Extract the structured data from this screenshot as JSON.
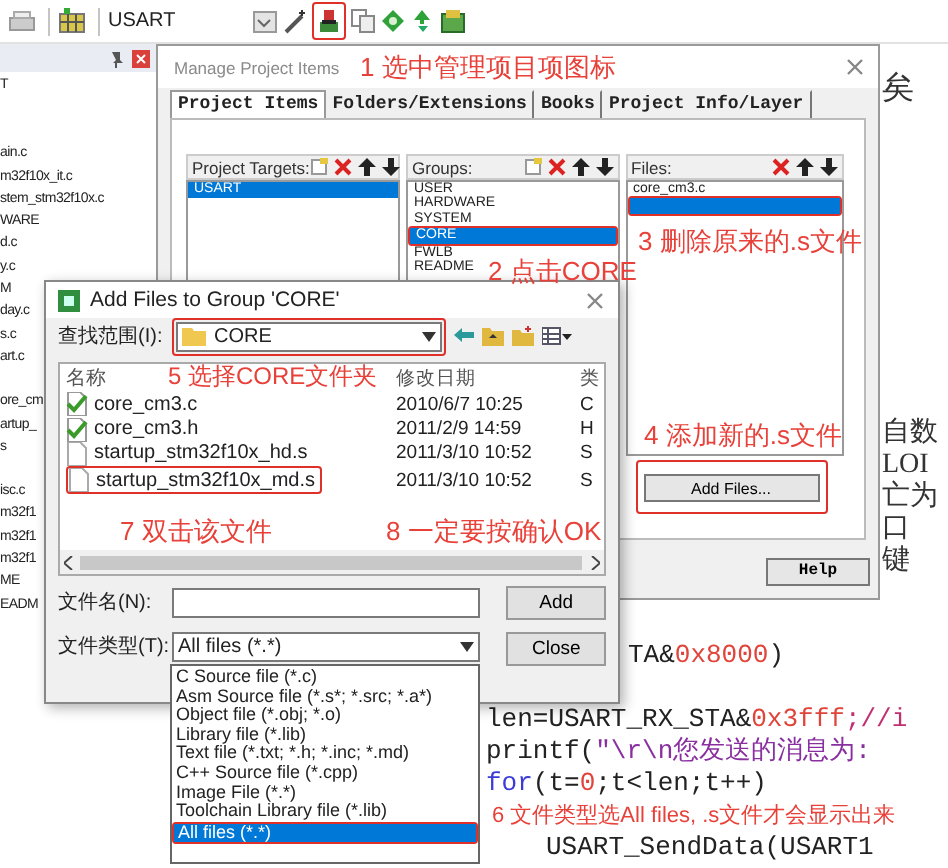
{
  "toolbar": {
    "target": "USART"
  },
  "sidebar": {
    "root": "T",
    "items": [
      "ain.c",
      "m32f10x_it.c",
      "stem_stm32f10x.c",
      "WARE",
      "d.c",
      "y.c",
      "M",
      "day.c",
      "s.c",
      "art.c",
      "ore_cm",
      "artup_",
      "s",
      "isc.c",
      "m32f1",
      "m32f1",
      "m32f1",
      "ME",
      "EADM"
    ]
  },
  "code_editor": {
    "side_fragments": [
      "矣",
      "自数",
      "LOI",
      "亡为",
      "口",
      "键"
    ],
    "partial_line": [
      {
        "text": "TA&",
        "kind": "plain"
      },
      {
        "text": "0x8000",
        "kind": "number"
      },
      {
        "text": ")",
        "kind": "plain"
      }
    ],
    "lines": [
      [
        {
          "text": "len=USART_RX_STA&",
          "kind": "plain"
        },
        {
          "text": "0x3fff",
          "kind": "number"
        },
        {
          "text": ";//i",
          "kind": "comment"
        }
      ],
      [
        {
          "text": "printf(",
          "kind": "plain"
        },
        {
          "text": "\"\\r\\n您发送的消息为:",
          "kind": "string"
        }
      ],
      [
        {
          "text": "for",
          "kind": "keyword"
        },
        {
          "text": "(t=",
          "kind": "plain"
        },
        {
          "text": "0",
          "kind": "number"
        },
        {
          "text": ";t<len;t++)",
          "kind": "plain"
        }
      ]
    ],
    "last_line": [
      {
        "text": "USART_SendData(USART1",
        "kind": "plain"
      }
    ]
  },
  "manage_dialog": {
    "title": "Manage Project Items",
    "tabs": [
      {
        "label": "Project Items",
        "selected": true
      },
      {
        "label": "Folders/Extensions",
        "selected": false
      },
      {
        "label": "Books",
        "selected": false
      },
      {
        "label": "Project Info/Layer",
        "selected": false
      }
    ],
    "targets": {
      "label": "Project Targets:",
      "items": [
        {
          "label": "USART",
          "selected": true
        }
      ]
    },
    "groups": {
      "label": "Groups:",
      "items": [
        {
          "label": "USER",
          "selected": false
        },
        {
          "label": "HARDWARE",
          "selected": false
        },
        {
          "label": "SYSTEM",
          "selected": false
        },
        {
          "label": "CORE",
          "selected": true
        },
        {
          "label": "FWLB",
          "selected": false
        },
        {
          "label": "README",
          "selected": false
        }
      ]
    },
    "files": {
      "label": "Files:",
      "items": [
        {
          "label": "core_cm3.c",
          "selected": false
        },
        {
          "selected": true
        }
      ]
    },
    "add_files_button": "Add Files...",
    "help_button": "Help"
  },
  "add_dialog": {
    "title": "Add Files to Group 'CORE'",
    "look_in_label": "查找范围(I):",
    "look_in": "CORE",
    "columns": [
      "名称",
      "修改日期",
      "类"
    ],
    "rows": [
      {
        "name": "core_cm3.c",
        "modified": "2010/6/7 10:25",
        "type": "C",
        "kind": "source"
      },
      {
        "name": "core_cm3.h",
        "modified": "2011/2/9 14:59",
        "type": "H",
        "kind": "source"
      },
      {
        "name": "startup_stm32f10x_hd.s",
        "modified": "2011/3/10 10:52",
        "type": "S",
        "kind": "plain"
      },
      {
        "name": "startup_stm32f10x_md.s",
        "modified": "2011/3/10 10:52",
        "type": "S",
        "kind": "plain"
      }
    ],
    "filename_label": "文件名(N):",
    "filetype_label": "文件类型(T):",
    "filetype": "All files (*.*)",
    "add_button": "Add",
    "close_button": "Close",
    "filetype_options": [
      {
        "label": "C Source file (*.c)",
        "selected": false
      },
      {
        "label": "Asm Source file (*.s*; *.src; *.a*)",
        "selected": false
      },
      {
        "label": "Object file (*.obj; *.o)",
        "selected": false
      },
      {
        "label": "Library file (*.lib)",
        "selected": false
      },
      {
        "label": "Text file (*.txt; *.h; *.inc; *.md)",
        "selected": false
      },
      {
        "label": "C++ Source file (*.cpp)",
        "selected": false
      },
      {
        "label": "Image File (*.*)",
        "selected": false
      },
      {
        "label": "Toolchain Library file (*.lib)",
        "selected": false
      },
      {
        "label": "All files (*.*)",
        "selected": true
      }
    ]
  },
  "annotations": [
    "1 选中管理项目项图标",
    "2 点击CORE",
    "3 删除原来的.s文件",
    "4 添加新的.s文件",
    "5 选择CORE文件夹",
    "6 文件类型选All files, .s文件才会显示出来",
    "7 双击该文件",
    "8 一定要按确认OK"
  ]
}
